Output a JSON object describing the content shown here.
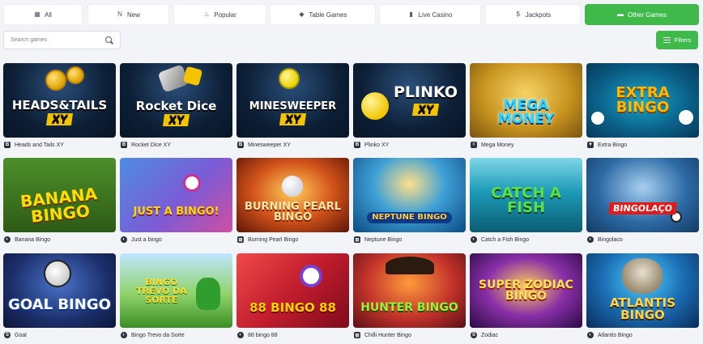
{
  "tabs": [
    {
      "label": "All",
      "icon": "grid-icon",
      "glyph": "▦",
      "active": false
    },
    {
      "label": "New",
      "icon": "new-icon",
      "glyph": "N",
      "active": false
    },
    {
      "label": "Popular",
      "icon": "flame-icon",
      "glyph": "♨",
      "active": false
    },
    {
      "label": "Table Games",
      "icon": "diamond-icon",
      "glyph": "◆",
      "active": false
    },
    {
      "label": "Live Casino",
      "icon": "live-icon",
      "glyph": "▮",
      "active": false
    },
    {
      "label": "Jackpots",
      "icon": "jackpot-icon",
      "glyph": "$",
      "active": false
    },
    {
      "label": "Other Games",
      "icon": "gamepad-icon",
      "glyph": "▬",
      "active": true
    }
  ],
  "search": {
    "placeholder": "Search games",
    "value": ""
  },
  "filters": {
    "label": "Filters"
  },
  "accent_color": "#3fb94a",
  "games": [
    {
      "name": "Heads and Tails XY",
      "art": "HEADS&TAILS",
      "sub": "XY",
      "provider_glyph": "B"
    },
    {
      "name": "Rocket Dice XY",
      "art": "Rocket Dice",
      "sub": "XY",
      "provider_glyph": "B"
    },
    {
      "name": "Minesweeper XY",
      "art": "MINESWEEPER",
      "sub": "XY",
      "provider_glyph": "B"
    },
    {
      "name": "Plinko XY",
      "art": "PLINKO",
      "sub": "XY",
      "provider_glyph": "B"
    },
    {
      "name": "Mega Money",
      "art": "MEGA MONEY",
      "sub": "",
      "provider_glyph": "="
    },
    {
      "name": "Extra Bingo",
      "art": "EXTRA BINGO",
      "sub": "",
      "provider_glyph": "▼"
    },
    {
      "name": "Banana Bingo",
      "art": "BANANA BINGO",
      "sub": "",
      "provider_glyph": "◐"
    },
    {
      "name": "Just a bingo",
      "art": "JUST A BINGO!",
      "sub": "",
      "provider_glyph": "◐"
    },
    {
      "name": "Burning Pearl Bingo",
      "art": "BURNING PEARL BINGO",
      "sub": "",
      "provider_glyph": "⊞"
    },
    {
      "name": "Neptune Bingo",
      "art": "NEPTUNE BINGO",
      "sub": "",
      "provider_glyph": "⊞"
    },
    {
      "name": "Catch a Fish Bingo",
      "art": "CATCH A FISH",
      "sub": "",
      "provider_glyph": "◐"
    },
    {
      "name": "Bingolaco",
      "art": "BINGOLAÇO",
      "sub": "",
      "provider_glyph": "◐"
    },
    {
      "name": "Goal",
      "art": "GOAL BINGO",
      "sub": "",
      "provider_glyph": "S"
    },
    {
      "name": "Bingo Trevo da Sorte",
      "art": "BINGO TREVO DA SORTE",
      "sub": "",
      "provider_glyph": "◐"
    },
    {
      "name": "88 bingo 88",
      "art": "88 BINGO 88",
      "sub": "",
      "provider_glyph": "◐"
    },
    {
      "name": "Chilli Hunter Bingo",
      "art": "HUNTER BINGO",
      "sub": "",
      "provider_glyph": "⊞"
    },
    {
      "name": "Zodiac",
      "art": "SUPER ZODIAC BINGO",
      "sub": "",
      "provider_glyph": "S"
    },
    {
      "name": "Atlantis Bingo",
      "art": "ATLANTIS BINGO",
      "sub": "",
      "provider_glyph": "◐"
    }
  ]
}
